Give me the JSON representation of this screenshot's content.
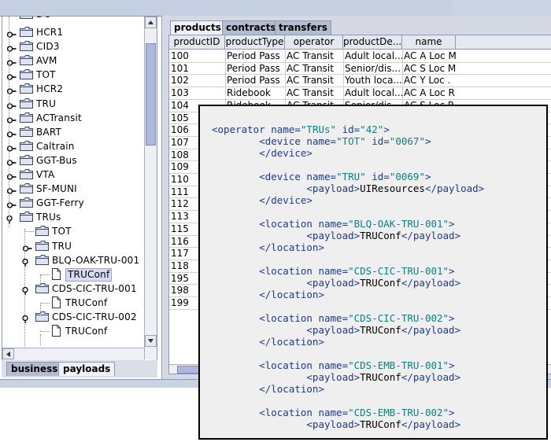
{
  "tree": {
    "partial_top": "DC",
    "items": [
      {
        "label": "HCR1",
        "type": "folder",
        "state": "collapsed"
      },
      {
        "label": "CID3",
        "type": "folder",
        "state": "collapsed"
      },
      {
        "label": "AVM",
        "type": "folder",
        "state": "collapsed"
      },
      {
        "label": "TOT",
        "type": "folder",
        "state": "collapsed"
      },
      {
        "label": "HCR2",
        "type": "folder",
        "state": "collapsed"
      },
      {
        "label": "TRU",
        "type": "folder",
        "state": "collapsed"
      },
      {
        "label": "ACTransit",
        "type": "folder",
        "state": "collapsed"
      },
      {
        "label": "BART",
        "type": "folder",
        "state": "collapsed"
      },
      {
        "label": "Caltrain",
        "type": "folder",
        "state": "collapsed"
      },
      {
        "label": "GGT-Bus",
        "type": "folder",
        "state": "collapsed"
      },
      {
        "label": "VTA",
        "type": "folder",
        "state": "collapsed"
      },
      {
        "label": "SF-MUNI",
        "type": "folder",
        "state": "collapsed"
      },
      {
        "label": "GGT-Ferry",
        "type": "folder",
        "state": "collapsed"
      },
      {
        "label": "TRUs",
        "type": "folder",
        "state": "expanded"
      },
      {
        "label": "TOT",
        "type": "folder",
        "state": "leaf"
      },
      {
        "label": "TRU",
        "type": "folder",
        "state": "collapsed"
      },
      {
        "label": "BLQ-OAK-TRU-001",
        "type": "folder",
        "state": "expanded"
      },
      {
        "label": "TRUConf",
        "type": "doc",
        "state": "selected"
      },
      {
        "label": "CDS-CIC-TRU-001",
        "type": "folder",
        "state": "expanded"
      },
      {
        "label": "TRUConf",
        "type": "doc",
        "state": "leaf"
      },
      {
        "label": "CDS-CIC-TRU-002",
        "type": "folder",
        "state": "expanded"
      },
      {
        "label": "TRUConf",
        "type": "doc",
        "state": "leaf"
      }
    ]
  },
  "left_tabs": [
    "business",
    "payloads"
  ],
  "right_tabs": [
    "products",
    "contracts",
    "transfers"
  ],
  "table": {
    "columns": [
      "productID",
      "productType",
      "operator",
      "productDe...",
      "name"
    ],
    "rows": [
      [
        "100",
        "Period Pass",
        "AC Transit",
        "Adult local...",
        "AC A Loc M"
      ],
      [
        "101",
        "Period Pass",
        "AC Transit",
        "Senior/dis...",
        "AC S Loc M"
      ],
      [
        "102",
        "Period Pass",
        "AC Transit",
        "Youth loca...",
        "AC Y Loc ."
      ],
      [
        "103",
        "Ridebook",
        "AC Transit",
        "Adult local...",
        "AC A Loc R"
      ],
      [
        "104",
        "Ridebook",
        "AC Transit",
        "Senior/dis...",
        "AC S Loc R"
      ],
      [
        "105",
        "",
        "",
        "",
        ""
      ],
      [
        "106",
        "",
        "",
        "",
        ""
      ],
      [
        "107",
        "",
        "",
        "",
        ""
      ],
      [
        "108",
        "",
        "",
        "",
        ""
      ],
      [
        "109",
        "",
        "",
        "",
        ""
      ],
      [
        "110",
        "",
        "",
        "",
        ""
      ],
      [
        "111",
        "",
        "",
        "",
        ""
      ],
      [
        "112",
        "",
        "",
        "",
        ""
      ],
      [
        "113",
        "",
        "",
        "",
        ""
      ],
      [
        "115",
        "",
        "",
        "",
        ""
      ],
      [
        "116",
        "",
        "",
        "",
        ""
      ],
      [
        "117",
        "",
        "",
        "",
        ""
      ],
      [
        "118",
        "",
        "",
        "",
        ""
      ],
      [
        "195",
        "",
        "",
        "",
        ""
      ],
      [
        "198",
        "",
        "",
        "",
        ""
      ],
      [
        "199",
        "",
        "",
        "",
        ""
      ]
    ]
  },
  "xml": {
    "lines": [
      [
        [
          "tg",
          "<operator "
        ],
        [
          "tg",
          "name="
        ],
        [
          "av",
          "\"TRUs\""
        ],
        [
          "tg",
          " id="
        ],
        [
          "av",
          "\"42\""
        ],
        [
          "tg",
          ">"
        ]
      ],
      [
        [
          "tg",
          "        <device "
        ],
        [
          "tg",
          "name="
        ],
        [
          "av",
          "\"TOT\""
        ],
        [
          "tg",
          " id="
        ],
        [
          "av",
          "\"0067\""
        ],
        [
          "tg",
          ">"
        ]
      ],
      [
        [
          "tg",
          "        </device>"
        ]
      ],
      [],
      [
        [
          "tg",
          "        <device "
        ],
        [
          "tg",
          "name="
        ],
        [
          "av",
          "\"TRU\""
        ],
        [
          "tg",
          " id="
        ],
        [
          "av",
          "\"0069\""
        ],
        [
          "tg",
          ">"
        ]
      ],
      [
        [
          "tg",
          "                <payload>"
        ],
        [
          "tx",
          "UIResources"
        ],
        [
          "tg",
          "</payload>"
        ]
      ],
      [
        [
          "tg",
          "        </device>"
        ]
      ],
      [],
      [
        [
          "tg",
          "        <location "
        ],
        [
          "tg",
          "name="
        ],
        [
          "av",
          "\"BLQ-OAK-TRU-001\""
        ],
        [
          "tg",
          ">"
        ]
      ],
      [
        [
          "tg",
          "                <payload>"
        ],
        [
          "tx",
          "TRUConf"
        ],
        [
          "tg",
          "</payload>"
        ]
      ],
      [
        [
          "tg",
          "        </location>"
        ]
      ],
      [],
      [
        [
          "tg",
          "        <location "
        ],
        [
          "tg",
          "name="
        ],
        [
          "av",
          "\"CDS-CIC-TRU-001\""
        ],
        [
          "tg",
          ">"
        ]
      ],
      [
        [
          "tg",
          "                <payload>"
        ],
        [
          "tx",
          "TRUConf"
        ],
        [
          "tg",
          "</payload>"
        ]
      ],
      [
        [
          "tg",
          "        </location>"
        ]
      ],
      [],
      [
        [
          "tg",
          "        <location "
        ],
        [
          "tg",
          "name="
        ],
        [
          "av",
          "\"CDS-CIC-TRU-002\""
        ],
        [
          "tg",
          ">"
        ]
      ],
      [
        [
          "tg",
          "                <payload>"
        ],
        [
          "tx",
          "TRUConf"
        ],
        [
          "tg",
          "</payload>"
        ]
      ],
      [
        [
          "tg",
          "        </location>"
        ]
      ],
      [],
      [
        [
          "tg",
          "        <location "
        ],
        [
          "tg",
          "name="
        ],
        [
          "av",
          "\"CDS-EMB-TRU-001\""
        ],
        [
          "tg",
          ">"
        ]
      ],
      [
        [
          "tg",
          "                <payload>"
        ],
        [
          "tx",
          "TRUConf"
        ],
        [
          "tg",
          "</payload>"
        ]
      ],
      [
        [
          "tg",
          "        </location>"
        ]
      ],
      [],
      [
        [
          "tg",
          "        <location "
        ],
        [
          "tg",
          "name="
        ],
        [
          "av",
          "\"CDS-EMB-TRU-002\""
        ],
        [
          "tg",
          ">"
        ]
      ],
      [
        [
          "tg",
          "                <payload>"
        ],
        [
          "tx",
          "TRUConf"
        ],
        [
          "tg",
          "</payload>"
        ]
      ]
    ]
  },
  "colors": {
    "tag": "#1e3a8a",
    "attr_value": "#0f7f7f",
    "selection": "#d5daf5",
    "scroll_thumb": "#aeb8db"
  }
}
